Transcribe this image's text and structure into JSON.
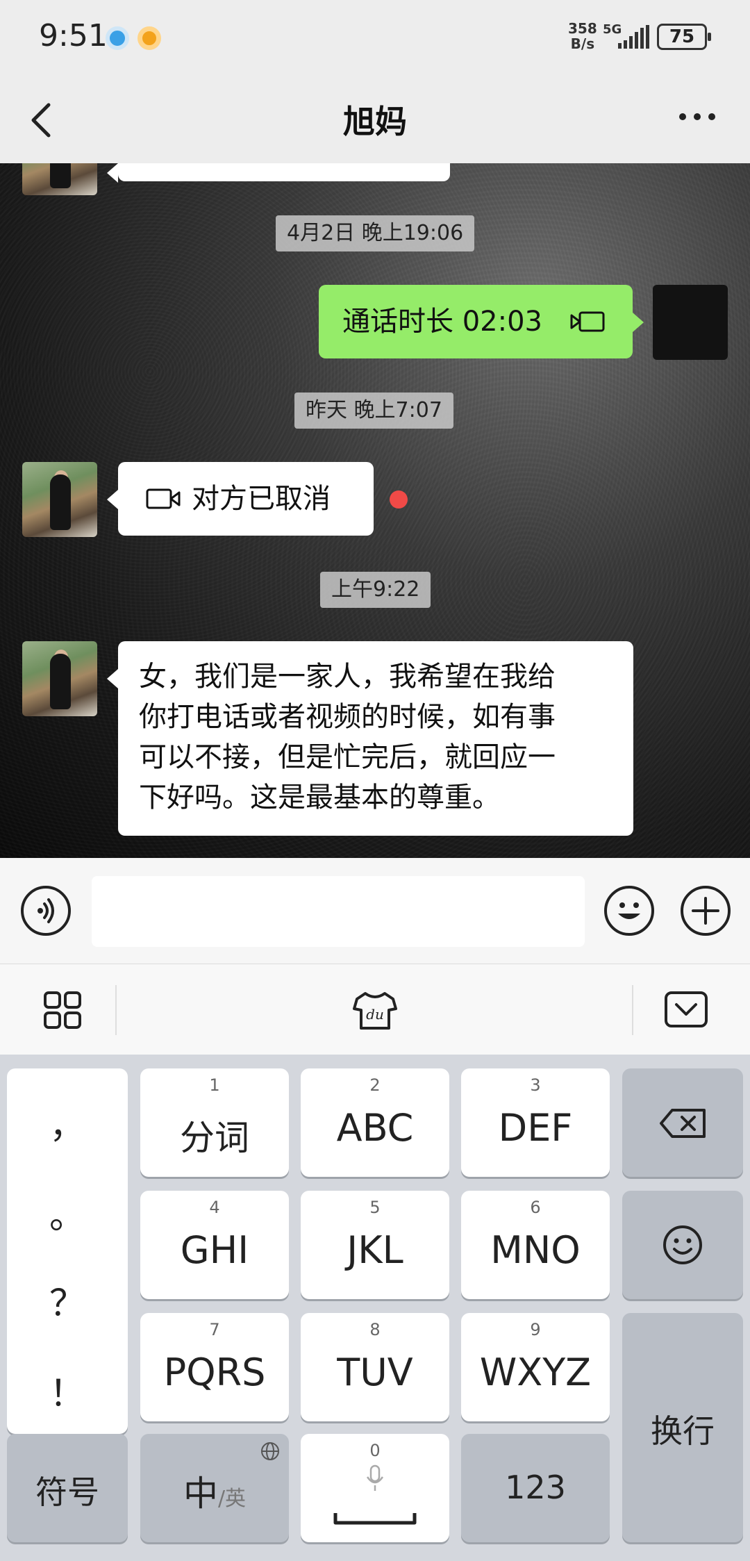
{
  "status_bar": {
    "time": "9:51",
    "net_speed_value": "358",
    "net_speed_unit": "B/s",
    "network": "5G",
    "battery": "75"
  },
  "nav": {
    "title": "旭妈"
  },
  "messages": [
    {
      "type": "timestamp",
      "text": "4月2日 晚上19:06"
    },
    {
      "type": "call",
      "from": "me",
      "text": "通话时长 02:03",
      "icon": "video-call-icon"
    },
    {
      "type": "timestamp",
      "text": "昨天 晚上7:07"
    },
    {
      "type": "call",
      "from": "other",
      "text": "对方已取消",
      "icon": "video-call-icon",
      "unread": true
    },
    {
      "type": "timestamp",
      "text": "上午9:22"
    },
    {
      "type": "text",
      "from": "other",
      "lines": [
        "女，我们是一家人，我希望在我给",
        "你打电话或者视频的时候，如有事",
        "可以不接，但是忙完后，就回应一",
        "下好吗。这是最基本的尊重。"
      ]
    }
  ],
  "input": {
    "value": ""
  },
  "keyboard": {
    "punctuation": [
      "，",
      "。",
      "？",
      "！"
    ],
    "rows": [
      [
        {
          "num": "1",
          "label": "分词"
        },
        {
          "num": "2",
          "label": "ABC"
        },
        {
          "num": "3",
          "label": "DEF"
        }
      ],
      [
        {
          "num": "4",
          "label": "GHI"
        },
        {
          "num": "5",
          "label": "JKL"
        },
        {
          "num": "6",
          "label": "MNO"
        }
      ],
      [
        {
          "num": "7",
          "label": "PQRS"
        },
        {
          "num": "8",
          "label": "TUV"
        },
        {
          "num": "9",
          "label": "WXYZ"
        }
      ]
    ],
    "symbols_label": "符号",
    "lang_main": "中",
    "lang_alt": "/英",
    "space_num": "0",
    "numbers_label": "123",
    "enter_label": "换行",
    "toolbar_logo_text": "du"
  },
  "colors": {
    "my_bubble": "#95ec69",
    "their_bubble": "#ffffff",
    "unread_dot": "#f04a47"
  }
}
